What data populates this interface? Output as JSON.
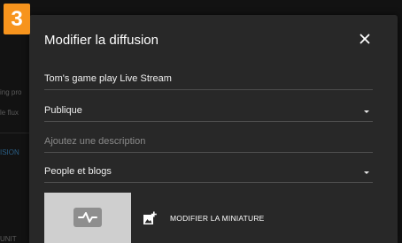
{
  "step_badge": "3",
  "background": {
    "snippets": [
      "ing pro",
      "le flux",
      "ISION",
      "UNIT"
    ]
  },
  "dialog": {
    "title": "Modifier la diffusion",
    "close_icon": "close-icon",
    "fields": {
      "title_value": "Tom's game play Live Stream",
      "privacy_value": "Publique",
      "description_placeholder": "Ajoutez une description",
      "category_value": "People et blogs"
    },
    "thumbnail": {
      "icon": "waveform-icon",
      "modify_label": "MODIFIER LA MINIATURE",
      "modify_icon": "add-photo-icon"
    }
  },
  "colors": {
    "badge": "#f7941d",
    "dialog_bg": "#282828",
    "background": "#121212",
    "link": "#2a5f86"
  }
}
